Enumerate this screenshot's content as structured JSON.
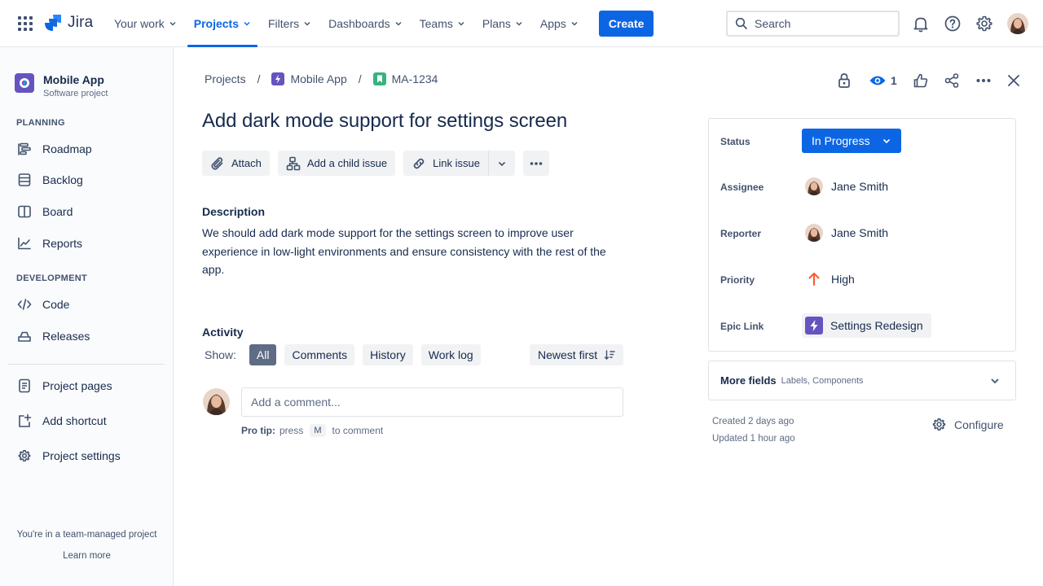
{
  "topnav": {
    "logo_text": "Jira",
    "items": [
      {
        "label": "Your work"
      },
      {
        "label": "Projects"
      },
      {
        "label": "Filters"
      },
      {
        "label": "Dashboards"
      },
      {
        "label": "Teams"
      },
      {
        "label": "Plans"
      },
      {
        "label": "Apps"
      }
    ],
    "active_item": "Projects",
    "create_label": "Create",
    "search_placeholder": "Search",
    "icons": [
      "app-switcher-icon",
      "bell-icon",
      "help-icon",
      "gear-icon",
      "profile-avatar"
    ]
  },
  "sidebar": {
    "project_name": "Mobile App",
    "project_type": "Software project",
    "planning_title": "PLANNING",
    "planning_items": [
      {
        "label": "Roadmap",
        "icon": "roadmap-icon"
      },
      {
        "label": "Backlog",
        "icon": "backlog-icon"
      },
      {
        "label": "Board",
        "icon": "board-icon"
      },
      {
        "label": "Reports",
        "icon": "reports-icon"
      }
    ],
    "development_title": "DEVELOPMENT",
    "development_items": [
      {
        "label": "Code",
        "icon": "code-icon"
      },
      {
        "label": "Releases",
        "icon": "releases-icon"
      }
    ],
    "other_items": [
      {
        "label": "Project pages",
        "icon": "page-icon"
      },
      {
        "label": "Add shortcut",
        "icon": "add-shortcut-icon"
      },
      {
        "label": "Project settings",
        "icon": "gear-icon"
      }
    ],
    "footer_text": "You're in a team-managed project",
    "footer_link": "Learn more"
  },
  "breadcrumb": {
    "items": [
      "Projects",
      "Mobile App",
      "MA-1234"
    ],
    "separator": "/"
  },
  "issue": {
    "title": "Add dark mode support for settings screen",
    "actions": {
      "attach": "Attach",
      "add_child": "Add a child issue",
      "link_issue": "Link issue"
    },
    "description_label": "Description",
    "description": "We should add dark mode support for the settings screen to improve user experience in low-light environments and ensure consistency with the rest of the app."
  },
  "activity": {
    "label": "Activity",
    "show_label": "Show:",
    "filters": [
      "All",
      "Comments",
      "History",
      "Work log"
    ],
    "active_filter": "All",
    "sort_label": "Newest first",
    "comment_placeholder": "Add a comment...",
    "protip_bold": "Pro tip:",
    "protip_press": "press",
    "protip_key": "M",
    "protip_rest": "to comment"
  },
  "toolbar": {
    "watchers_count": "1"
  },
  "details": {
    "status_label": "Status",
    "status_value": "In Progress",
    "assignee_label": "Assignee",
    "assignee_value": "Jane Smith",
    "reporter_label": "Reporter",
    "reporter_value": "Jane Smith",
    "priority_label": "Priority",
    "priority_value": "High",
    "epic_label": "Epic Link",
    "epic_value": "Settings Redesign"
  },
  "more_fields": {
    "title": "More fields",
    "subtitle": "Labels, Components"
  },
  "meta": {
    "created": "Created 2 days ago",
    "updated": "Updated 1 hour ago",
    "configure_label": "Configure"
  },
  "colors": {
    "accent": "#0c66e4",
    "project_purple": "#6554c0",
    "story_green": "#36b37e",
    "priority_high": "#ff5630"
  }
}
